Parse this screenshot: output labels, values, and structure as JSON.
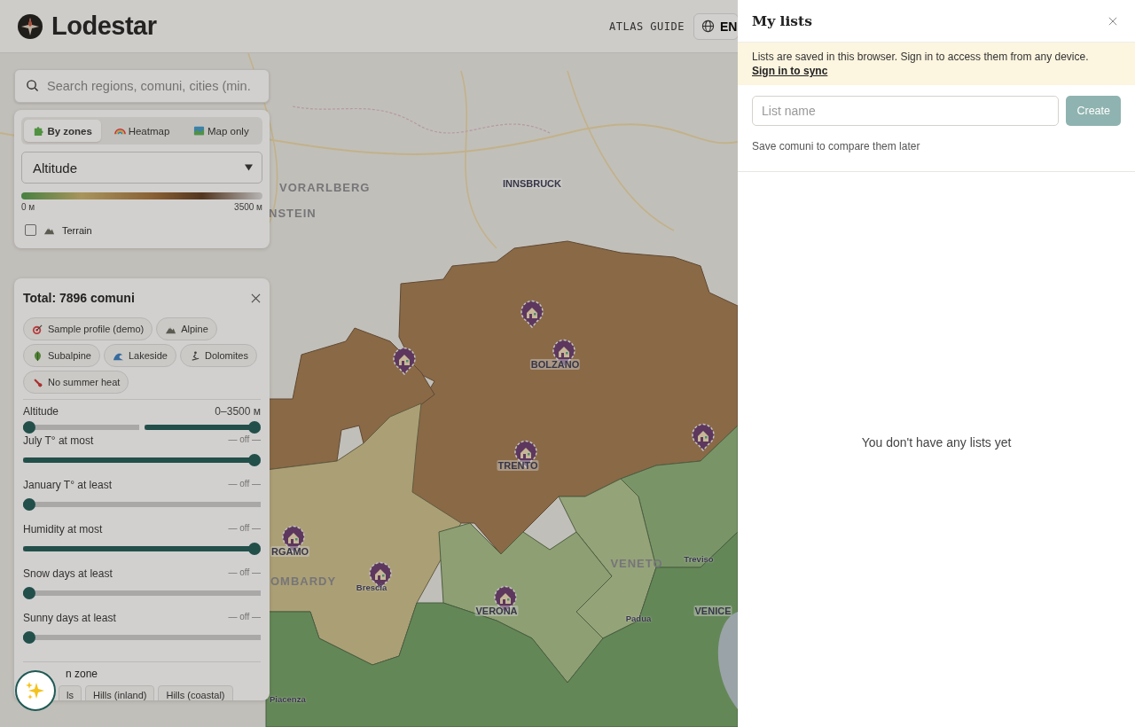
{
  "header": {
    "brand": "Lodestar",
    "nav_link": "ATLAS GUIDE",
    "language": "EN"
  },
  "search": {
    "placeholder": "Search regions, comuni, cities (min."
  },
  "view_modes": [
    {
      "label": "By zones",
      "selected": true
    },
    {
      "label": "Heatmap",
      "selected": false
    },
    {
      "label": "Map only",
      "selected": false
    }
  ],
  "metric": {
    "value": "Altitude"
  },
  "legend": {
    "min": "0 м",
    "max": "3500 м"
  },
  "terrain": {
    "label": "Terrain",
    "checked": false
  },
  "filters": {
    "title": "Total: 7896 comuni",
    "presets": [
      "Sample profile (demo)",
      "Alpine",
      "Subalpine",
      "Lakeside",
      "Dolomites",
      "No summer heat"
    ],
    "sliders": [
      {
        "kind": "range",
        "label": "Altitude",
        "reading": "0–3500 м",
        "min": {
          "level": 0
        },
        "max": {
          "level": 1
        }
      },
      {
        "kind": "single",
        "label": "July T° at most",
        "reading": "— off —",
        "level": 1
      },
      {
        "kind": "single",
        "label": "January T° at least",
        "reading": "— off —",
        "level": 0
      },
      {
        "kind": "single",
        "label": "Humidity at most",
        "reading": "— off —",
        "level": 1
      },
      {
        "kind": "single",
        "label": "Snow days at least",
        "reading": "— off —",
        "level": 0
      },
      {
        "kind": "single",
        "label": "Sunny days at least",
        "reading": "— off —",
        "level": 0
      }
    ],
    "zone_label": "n zone",
    "zone_chips": [
      "ls",
      "Hills (inland)",
      "Hills (coastal)"
    ]
  },
  "map": {
    "labels": [
      {
        "kind": "region",
        "text": "VORARLBERG"
      },
      {
        "kind": "region",
        "text": "NSTEIN"
      },
      {
        "kind": "major",
        "text": "INNSBRUCK"
      },
      {
        "kind": "major",
        "text": "BOLZANO"
      },
      {
        "kind": "major",
        "text": "TRENTO"
      },
      {
        "kind": "major",
        "text": "RGAMO"
      },
      {
        "kind": "region",
        "text": "OMBARDY"
      },
      {
        "kind": "minor",
        "text": "Brescia"
      },
      {
        "kind": "major",
        "text": "VERONA"
      },
      {
        "kind": "region",
        "text": "VENETO"
      },
      {
        "kind": "minor",
        "text": "Treviso"
      },
      {
        "kind": "minor",
        "text": "Padua"
      },
      {
        "kind": "major",
        "text": "VENICE"
      },
      {
        "kind": "minor",
        "text": "Piacenza"
      }
    ]
  },
  "drawer": {
    "title": "My lists",
    "notice": "Lists are saved in this browser. Sign in to access them from any device.",
    "notice_link": "Sign in to sync",
    "input_placeholder": "List name",
    "create_button": {
      "label": "Create",
      "disabled": true
    },
    "hint": "Save comuni to compare them later",
    "empty": "You don't have any lists yet"
  }
}
